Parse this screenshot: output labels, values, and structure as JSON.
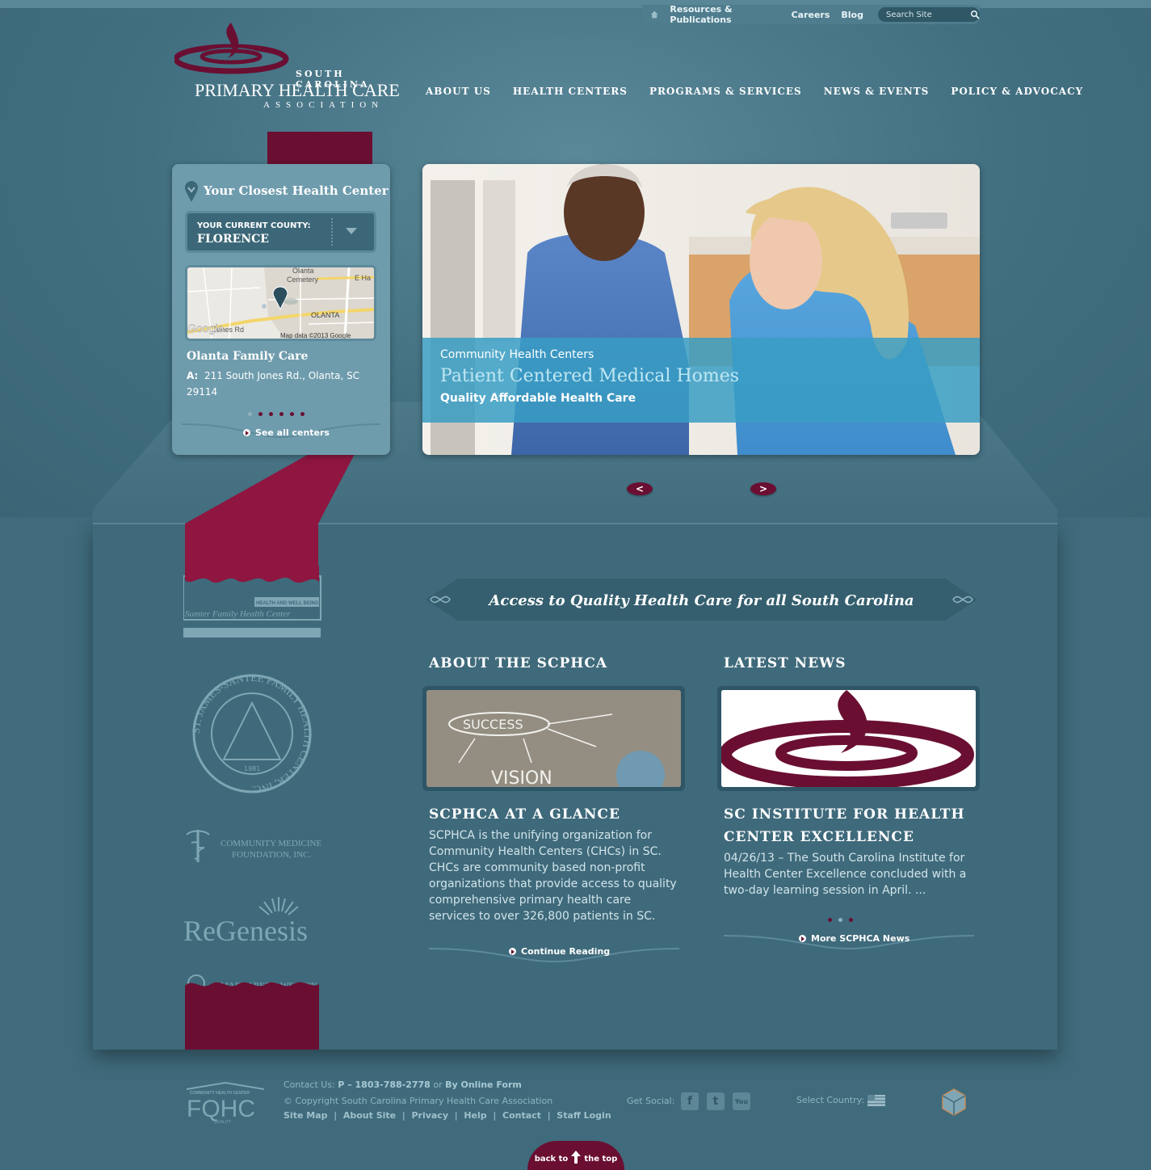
{
  "utility_nav": {
    "links": [
      "Resources & Publications",
      "Careers",
      "Blog"
    ],
    "search_placeholder": "Search Site"
  },
  "logo": {
    "line1": "SOUTH CAROLINA",
    "line2": "PRIMARY HEALTH CARE",
    "line3": "ASSOCIATION"
  },
  "main_nav": [
    "ABOUT US",
    "HEALTH CENTERS",
    "PROGRAMS & SERVICES",
    "NEWS & EVENTS",
    "POLICY & ADVOCACY"
  ],
  "health_center": {
    "title": "Your Closest Health Center",
    "county_label": "YOUR CURRENT COUNTY:",
    "county_value": "FLORENCE",
    "map_labels": [
      "Olanta",
      "Cemetery",
      "E Ha",
      "OLANTA",
      "Jones Rd",
      "Google",
      "Map data ©2013 Google"
    ],
    "name": "Olanta Family Care",
    "address_prefix": "A:",
    "address": "211 South Jones Rd., Olanta, SC 29114",
    "see_all": "See all centers"
  },
  "hero": {
    "line1": "Community Health Centers",
    "line2": "Patient Centered Medical Homes",
    "line3": "Quality Affordable Health Care",
    "prev": "<",
    "next": ">"
  },
  "tagline": "Access to Quality Health Care for all South Carolina",
  "about": {
    "heading": "ABOUT THE SCPHCA",
    "image_words": [
      "SUCCESS",
      "VISION"
    ],
    "subheading": "SCPHCA AT A GLANCE",
    "body": "SCPHCA is the unifying organization for Community Health Centers (CHCs) in SC. CHCs are community based non-profit organizations that provide access to quality comprehensive primary health care services to over 326,800 patients in SC.",
    "link": "Continue Reading"
  },
  "news": {
    "heading": "LATEST NEWS",
    "subheading": "SC INSTITUTE FOR HEALTH CENTER EXCELLENCE",
    "body": "04/26/13 – The South Carolina Institute for Health Center Excellence concluded with a two-day learning session in April. ...",
    "link": "More SCPHCA News"
  },
  "member_logos": {
    "sumter": "Sumter Family Health Center",
    "sumter_tag": "HEALTH AND WELL BEING",
    "santee": "ST. JAMES-SANTEE FAMILY HEALTH CENTER, INC.",
    "santee_year": "1981",
    "cmf_line1": "COMMUNITY MEDICINE",
    "cmf_line2": "FOUNDATION, INC.",
    "regenesis": "ReGenesis",
    "weston": "MARGARET J. WESTON"
  },
  "footer": {
    "contact_prefix": "Contact Us:",
    "phone": "P – 1803-788-2778",
    "or": "or",
    "online_form": "By Online Form",
    "copyright": "© Copyright South Carolina Primary Health Care Association",
    "links": [
      "Site Map",
      "About Site",
      "Privacy",
      "Help",
      "Contact",
      "Staff Login"
    ],
    "get_social": "Get Social:",
    "select_country": "Select Country:",
    "fqhc_top": "COMMUNITY HEALTH CENTER",
    "fqhc": "FQHC",
    "fqhc_sub": "QUALITY",
    "back_to": "back to",
    "the_top": "the top"
  },
  "colors": {
    "background": "#3f6b7c",
    "burgundy": "#6a0f32",
    "hero_caption": "#389dc4",
    "panel_box": "#6f9cad"
  }
}
